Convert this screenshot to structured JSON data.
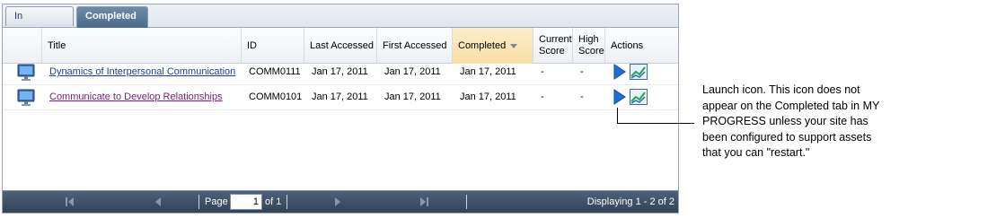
{
  "tabs": [
    {
      "label": "In Progress",
      "active": false
    },
    {
      "label": "Completed",
      "active": true
    }
  ],
  "columns": {
    "title": "Title",
    "id": "ID",
    "last_accessed": "Last Accessed",
    "first_accessed": "First Accessed",
    "completed": "Completed",
    "current_score_line1": "Current",
    "current_score_line2": "Score",
    "high_score_line1": "High",
    "high_score_line2": "Score",
    "actions": "Actions"
  },
  "rows": [
    {
      "title": "Dynamics of Interpersonal Communication",
      "id": "COMM0111",
      "last_accessed": "Jan 17, 2011",
      "first_accessed": "Jan 17, 2011",
      "completed": "Jan 17, 2011",
      "current_score": "-",
      "high_score": "-"
    },
    {
      "title": "Communicate to Develop Relationships",
      "id": "COMM0101",
      "last_accessed": "Jan 17, 2011",
      "first_accessed": "Jan 17, 2011",
      "completed": "Jan 17, 2011",
      "current_score": "-",
      "high_score": "-"
    }
  ],
  "pager": {
    "page_label": "Page",
    "page_value": "1",
    "of_label": "of 1",
    "displaying": "Displaying 1 - 2 of 2"
  },
  "callout": {
    "text": "Launch icon. This icon does not appear on the Completed tab in MY PROGRESS unless your site has been configured to support assets that you can \"restart.\""
  },
  "icons": {
    "row_type": "computer-monitor-icon",
    "launch": "play-launch-icon",
    "report": "progress-chart-icon"
  },
  "colors": {
    "tab_active": "#4b6a8c",
    "sorted_header": "#f7dfa6",
    "footer": "#2f435a",
    "link": "#551a8b"
  }
}
